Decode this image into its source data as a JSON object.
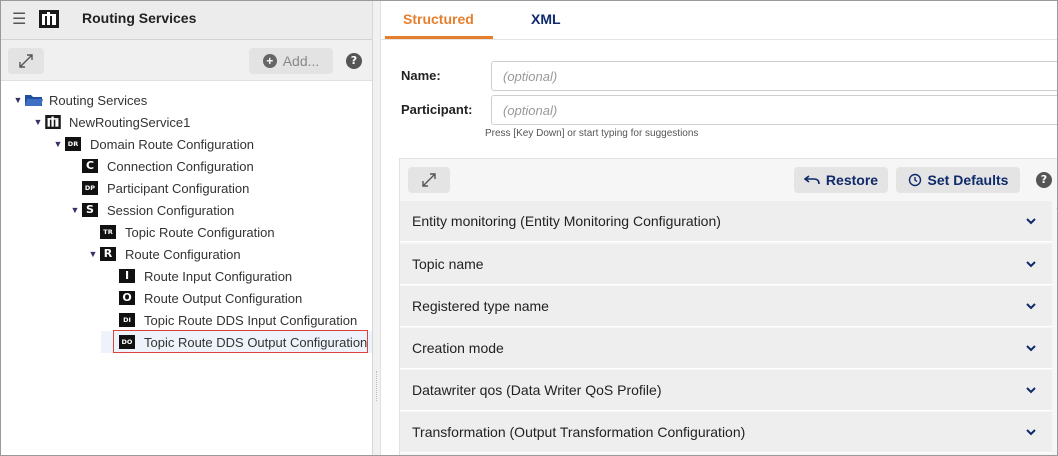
{
  "app": {
    "title": "Routing Services"
  },
  "left_toolbar": {
    "add_label": "Add...",
    "help": "?"
  },
  "tree": [
    {
      "label": "Routing Services",
      "badge": "",
      "icon": "folder-icon"
    },
    {
      "label": "NewRoutingService1",
      "badge": "",
      "icon": "routing-service-icon"
    },
    {
      "label": "Domain Route Configuration",
      "badge": "DR"
    },
    {
      "label": "Connection Configuration",
      "badge": "C"
    },
    {
      "label": "Participant Configuration",
      "badge": "DP"
    },
    {
      "label": "Session Configuration",
      "badge": "S"
    },
    {
      "label": "Topic Route Configuration",
      "badge": "TR"
    },
    {
      "label": "Route Configuration",
      "badge": "R"
    },
    {
      "label": "Route Input Configuration",
      "badge": "I"
    },
    {
      "label": "Route Output Configuration",
      "badge": "O"
    },
    {
      "label": "Topic Route DDS Input Configuration",
      "badge": "DI"
    },
    {
      "label": "Topic Route DDS Output Configuration",
      "badge": "DO"
    }
  ],
  "tabs": {
    "structured": "Structured",
    "xml": "XML"
  },
  "form": {
    "name_label": "Name:",
    "name_placeholder": "(optional)",
    "participant_label": "Participant:",
    "participant_placeholder": "(optional)",
    "hint": "Press [Key Down] or start typing for suggestions"
  },
  "form_toolbar": {
    "restore": "Restore",
    "set_defaults": "Set Defaults",
    "help": "?"
  },
  "sections": [
    "Entity monitoring (Entity Monitoring Configuration)",
    "Topic name",
    "Registered type name",
    "Creation mode",
    "Datawriter qos (Data Writer QoS Profile)",
    "Transformation (Output Transformation Configuration)"
  ],
  "colors": {
    "accent": "#e57f2d",
    "link": "#0f2a6b",
    "selection_border": "#d9423d"
  }
}
